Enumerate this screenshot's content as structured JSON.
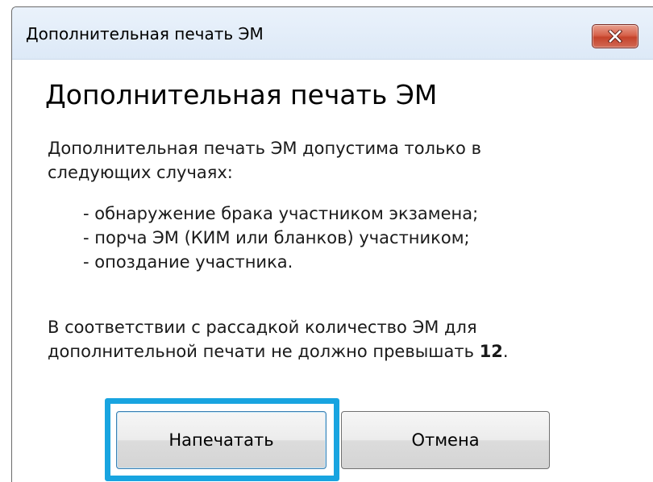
{
  "window": {
    "title": "Дополнительная печать ЭМ",
    "close_icon": "close-x-icon"
  },
  "dialog": {
    "heading": "Дополнительная печать ЭМ",
    "intro_line1": "Дополнительная печать ЭМ допустима только в",
    "intro_line2": "следующих случаях:",
    "cases": [
      "- обнаружение брака участником экзамена;",
      "- порча ЭМ (КИМ или бланков) участником;",
      "- опоздание участника."
    ],
    "limit_line1": "В соответствии с рассадкой количество ЭМ для",
    "limit_line2_prefix": "дополнительной печати не должно превышать",
    "limit_count": "12",
    "limit_suffix": "."
  },
  "buttons": {
    "print_label": "Напечатать",
    "cancel_label": "Отмена"
  },
  "colors": {
    "focus_ring": "#18a4e0",
    "close_button": "#c5432b",
    "titlebar": "#dde9f7"
  }
}
